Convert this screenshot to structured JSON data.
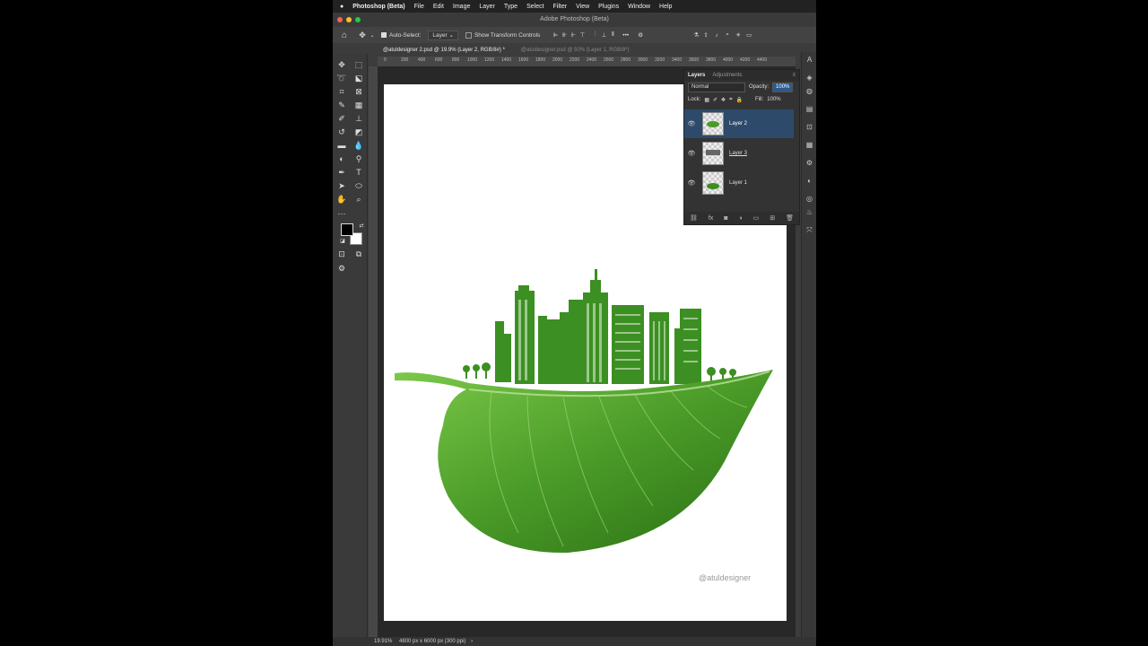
{
  "menubar": {
    "apple": "",
    "app_name": "Photoshop (Beta)",
    "items": [
      "File",
      "Edit",
      "Image",
      "Layer",
      "Type",
      "Select",
      "Filter",
      "View",
      "Plugins",
      "Window",
      "Help"
    ]
  },
  "window_title": "Adobe Photoshop (Beta)",
  "options_bar": {
    "auto_select_label": "Auto-Select:",
    "auto_select_value": "Layer",
    "transform_label": "Show Transform Controls",
    "more": "•••"
  },
  "doc_tabs": [
    {
      "label": "@atuldesigner 2.psd @ 19.9% (Layer 2, RGB/8#) *"
    },
    {
      "label": "@atuldesigner.psd @ 50% (Layer 1, RGB/8*)"
    }
  ],
  "ruler_ticks": [
    "0",
    "200",
    "400",
    "600",
    "800",
    "1000",
    "1200",
    "1400",
    "1600",
    "1800",
    "2000",
    "2200",
    "2400",
    "2600",
    "2800",
    "3000",
    "3200",
    "3400",
    "3600",
    "3800",
    "4000",
    "4200",
    "4400"
  ],
  "layers_panel": {
    "tab_layers": "Layers",
    "tab_adjustments": "Adjustments",
    "blend_mode": "Normal",
    "opacity_label": "Opacity:",
    "opacity_value": "100%",
    "lock_label": "Lock:",
    "fill_label": "Fill:",
    "fill_value": "100%",
    "layers": [
      {
        "name": "Layer 2",
        "selected": true
      },
      {
        "name": "Layer 3",
        "selected": false
      },
      {
        "name": "Layer 1",
        "selected": false
      }
    ]
  },
  "canvas": {
    "watermark": "@atuldesigner"
  },
  "status": {
    "zoom": "19.91%",
    "doc_info": "4800 px x 6000 px (300 ppi)"
  },
  "colors": {
    "leaf_dark": "#2e7d18",
    "leaf_light": "#6cbf3a",
    "city_green": "#3c8f22",
    "selection_blue": "#2d4a6b"
  }
}
